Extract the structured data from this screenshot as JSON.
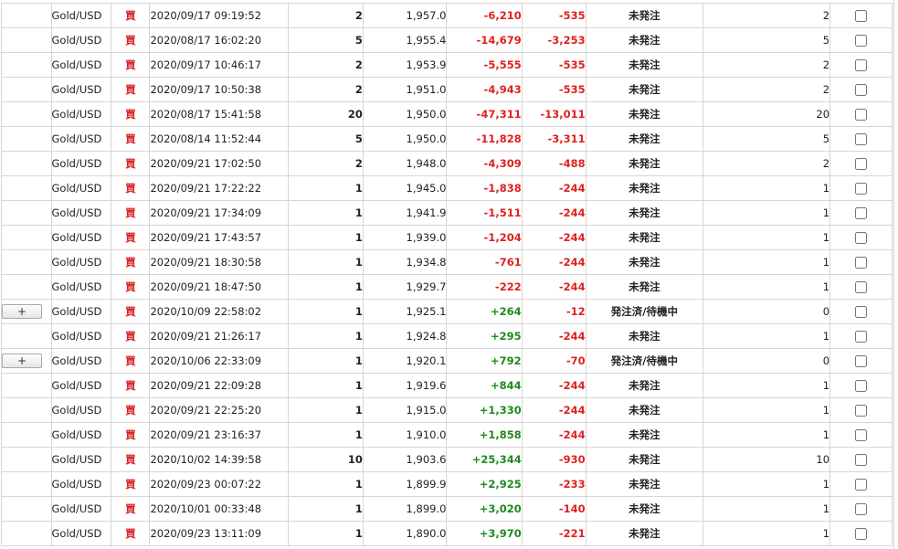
{
  "table": {
    "rows": [
      {
        "expand_label": "",
        "symbol": "Gold/USD",
        "side": "買",
        "time": "2020/09/17 09:19:52",
        "qty": "2",
        "price": "1,957.0",
        "pl": "-6,210",
        "swap": "-535",
        "status": "未発注",
        "available": "2"
      },
      {
        "expand_label": "",
        "symbol": "Gold/USD",
        "side": "買",
        "time": "2020/08/17 16:02:20",
        "qty": "5",
        "price": "1,955.4",
        "pl": "-14,679",
        "swap": "-3,253",
        "status": "未発注",
        "available": "5"
      },
      {
        "expand_label": "",
        "symbol": "Gold/USD",
        "side": "買",
        "time": "2020/09/17 10:46:17",
        "qty": "2",
        "price": "1,953.9",
        "pl": "-5,555",
        "swap": "-535",
        "status": "未発注",
        "available": "2"
      },
      {
        "expand_label": "",
        "symbol": "Gold/USD",
        "side": "買",
        "time": "2020/09/17 10:50:38",
        "qty": "2",
        "price": "1,951.0",
        "pl": "-4,943",
        "swap": "-535",
        "status": "未発注",
        "available": "2"
      },
      {
        "expand_label": "",
        "symbol": "Gold/USD",
        "side": "買",
        "time": "2020/08/17 15:41:58",
        "qty": "20",
        "price": "1,950.0",
        "pl": "-47,311",
        "swap": "-13,011",
        "status": "未発注",
        "available": "20"
      },
      {
        "expand_label": "",
        "symbol": "Gold/USD",
        "side": "買",
        "time": "2020/08/14 11:52:44",
        "qty": "5",
        "price": "1,950.0",
        "pl": "-11,828",
        "swap": "-3,311",
        "status": "未発注",
        "available": "5"
      },
      {
        "expand_label": "",
        "symbol": "Gold/USD",
        "side": "買",
        "time": "2020/09/21 17:02:50",
        "qty": "2",
        "price": "1,948.0",
        "pl": "-4,309",
        "swap": "-488",
        "status": "未発注",
        "available": "2"
      },
      {
        "expand_label": "",
        "symbol": "Gold/USD",
        "side": "買",
        "time": "2020/09/21 17:22:22",
        "qty": "1",
        "price": "1,945.0",
        "pl": "-1,838",
        "swap": "-244",
        "status": "未発注",
        "available": "1"
      },
      {
        "expand_label": "",
        "symbol": "Gold/USD",
        "side": "買",
        "time": "2020/09/21 17:34:09",
        "qty": "1",
        "price": "1,941.9",
        "pl": "-1,511",
        "swap": "-244",
        "status": "未発注",
        "available": "1"
      },
      {
        "expand_label": "",
        "symbol": "Gold/USD",
        "side": "買",
        "time": "2020/09/21 17:43:57",
        "qty": "1",
        "price": "1,939.0",
        "pl": "-1,204",
        "swap": "-244",
        "status": "未発注",
        "available": "1"
      },
      {
        "expand_label": "",
        "symbol": "Gold/USD",
        "side": "買",
        "time": "2020/09/21 18:30:58",
        "qty": "1",
        "price": "1,934.8",
        "pl": "-761",
        "swap": "-244",
        "status": "未発注",
        "available": "1"
      },
      {
        "expand_label": "",
        "symbol": "Gold/USD",
        "side": "買",
        "time": "2020/09/21 18:47:50",
        "qty": "1",
        "price": "1,929.7",
        "pl": "-222",
        "swap": "-244",
        "status": "未発注",
        "available": "1"
      },
      {
        "expand_label": "+",
        "symbol": "Gold/USD",
        "side": "買",
        "time": "2020/10/09 22:58:02",
        "qty": "1",
        "price": "1,925.1",
        "pl": "+264",
        "swap": "-12",
        "status": "発注済/待機中",
        "available": "0"
      },
      {
        "expand_label": "",
        "symbol": "Gold/USD",
        "side": "買",
        "time": "2020/09/21 21:26:17",
        "qty": "1",
        "price": "1,924.8",
        "pl": "+295",
        "swap": "-244",
        "status": "未発注",
        "available": "1"
      },
      {
        "expand_label": "+",
        "symbol": "Gold/USD",
        "side": "買",
        "time": "2020/10/06 22:33:09",
        "qty": "1",
        "price": "1,920.1",
        "pl": "+792",
        "swap": "-70",
        "status": "発注済/待機中",
        "available": "0"
      },
      {
        "expand_label": "",
        "symbol": "Gold/USD",
        "side": "買",
        "time": "2020/09/21 22:09:28",
        "qty": "1",
        "price": "1,919.6",
        "pl": "+844",
        "swap": "-244",
        "status": "未発注",
        "available": "1"
      },
      {
        "expand_label": "",
        "symbol": "Gold/USD",
        "side": "買",
        "time": "2020/09/21 22:25:20",
        "qty": "1",
        "price": "1,915.0",
        "pl": "+1,330",
        "swap": "-244",
        "status": "未発注",
        "available": "1"
      },
      {
        "expand_label": "",
        "symbol": "Gold/USD",
        "side": "買",
        "time": "2020/09/21 23:16:37",
        "qty": "1",
        "price": "1,910.0",
        "pl": "+1,858",
        "swap": "-244",
        "status": "未発注",
        "available": "1"
      },
      {
        "expand_label": "",
        "symbol": "Gold/USD",
        "side": "買",
        "time": "2020/10/02 14:39:58",
        "qty": "10",
        "price": "1,903.6",
        "pl": "+25,344",
        "swap": "-930",
        "status": "未発注",
        "available": "10"
      },
      {
        "expand_label": "",
        "symbol": "Gold/USD",
        "side": "買",
        "time": "2020/09/23 00:07:22",
        "qty": "1",
        "price": "1,899.9",
        "pl": "+2,925",
        "swap": "-233",
        "status": "未発注",
        "available": "1"
      },
      {
        "expand_label": "",
        "symbol": "Gold/USD",
        "side": "買",
        "time": "2020/10/01 00:33:48",
        "qty": "1",
        "price": "1,899.0",
        "pl": "+3,020",
        "swap": "-140",
        "status": "未発注",
        "available": "1"
      },
      {
        "expand_label": "",
        "symbol": "Gold/USD",
        "side": "買",
        "time": "2020/09/23 13:11:09",
        "qty": "1",
        "price": "1,890.0",
        "pl": "+3,970",
        "swap": "-221",
        "status": "未発注",
        "available": "1"
      }
    ]
  },
  "colors": {
    "negative": "#e02020",
    "positive": "#1e8a1e",
    "side_buy": "#d92020",
    "grid": "#d6d6d6"
  }
}
